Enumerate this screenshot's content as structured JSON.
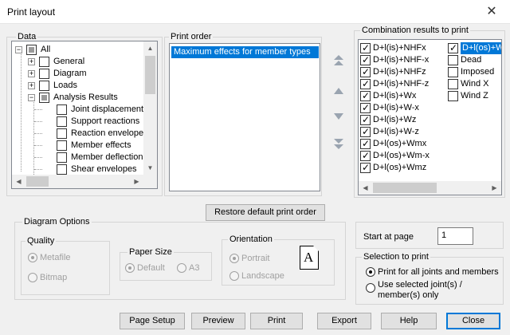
{
  "window": {
    "title": "Print layout",
    "close_icon": "close-icon"
  },
  "data_group": {
    "label": "Data",
    "tree": [
      {
        "label": "All",
        "state": "partial",
        "expander": "minus",
        "level": 0
      },
      {
        "label": "General",
        "state": "unchecked",
        "expander": "plus",
        "level": 1
      },
      {
        "label": "Diagram",
        "state": "unchecked",
        "expander": "plus",
        "level": 1
      },
      {
        "label": "Loads",
        "state": "unchecked",
        "expander": "plus",
        "level": 1
      },
      {
        "label": "Analysis Results",
        "state": "partial",
        "expander": "minus",
        "level": 1
      },
      {
        "label": "Joint displacements",
        "state": "unchecked",
        "level": 2
      },
      {
        "label": "Support reactions",
        "state": "unchecked",
        "level": 2
      },
      {
        "label": "Reaction envelopes",
        "state": "unchecked",
        "level": 2
      },
      {
        "label": "Member effects",
        "state": "unchecked",
        "level": 2
      },
      {
        "label": "Member deflections(I",
        "state": "unchecked",
        "level": 2
      },
      {
        "label": "Shear envelopes",
        "state": "unchecked",
        "level": 2
      }
    ]
  },
  "print_order": {
    "label": "Print order",
    "items": [
      "Maximum effects for member types"
    ]
  },
  "move_buttons": [
    "move-top-icon",
    "move-up-icon",
    "move-down-icon",
    "move-bottom-icon"
  ],
  "combination": {
    "label": "Combination results to print",
    "col1": [
      {
        "label": "D+l(is)+NHFx",
        "checked": true
      },
      {
        "label": "D+l(is)+NHF-x",
        "checked": true
      },
      {
        "label": "D+l(is)+NHFz",
        "checked": true
      },
      {
        "label": "D+l(is)+NHF-z",
        "checked": true
      },
      {
        "label": "D+l(is)+Wx",
        "checked": true
      },
      {
        "label": "D+l(is)+W-x",
        "checked": true
      },
      {
        "label": "D+l(is)+Wz",
        "checked": true
      },
      {
        "label": "D+l(is)+W-z",
        "checked": true
      },
      {
        "label": "D+l(os)+Wmx",
        "checked": true
      },
      {
        "label": "D+l(os)+Wm-x",
        "checked": true
      },
      {
        "label": "D+l(os)+Wmz",
        "checked": true
      }
    ],
    "col2": [
      {
        "label": "D+l(os)+Wm",
        "checked": true,
        "selected": true
      },
      {
        "label": "Dead",
        "checked": false
      },
      {
        "label": "Imposed",
        "checked": false
      },
      {
        "label": "Wind X",
        "checked": false
      },
      {
        "label": "Wind Z",
        "checked": false
      }
    ]
  },
  "restore_button": "Restore default print order",
  "diagram_options": {
    "label": "Diagram Options",
    "quality": {
      "label": "Quality",
      "options": [
        "Metafile",
        "Bitmap"
      ],
      "selected": "Metafile"
    },
    "paper": {
      "label": "Paper Size",
      "options": [
        "Default",
        "A3"
      ],
      "selected": "Default"
    },
    "orientation": {
      "label": "Orientation",
      "options": [
        "Portrait",
        "Landscape"
      ],
      "selected": "Portrait",
      "icon_letter": "A"
    }
  },
  "start_at_page": {
    "label": "Start at page",
    "value": "1"
  },
  "selection": {
    "label": "Selection to print",
    "options": [
      "Print for all joints and members",
      "Use selected joint(s) / member(s) only"
    ],
    "selected": 0
  },
  "buttons": {
    "page_setup": "Page Setup",
    "preview": "Preview",
    "print": "Print",
    "export": "Export",
    "help": "Help",
    "close": "Close"
  }
}
